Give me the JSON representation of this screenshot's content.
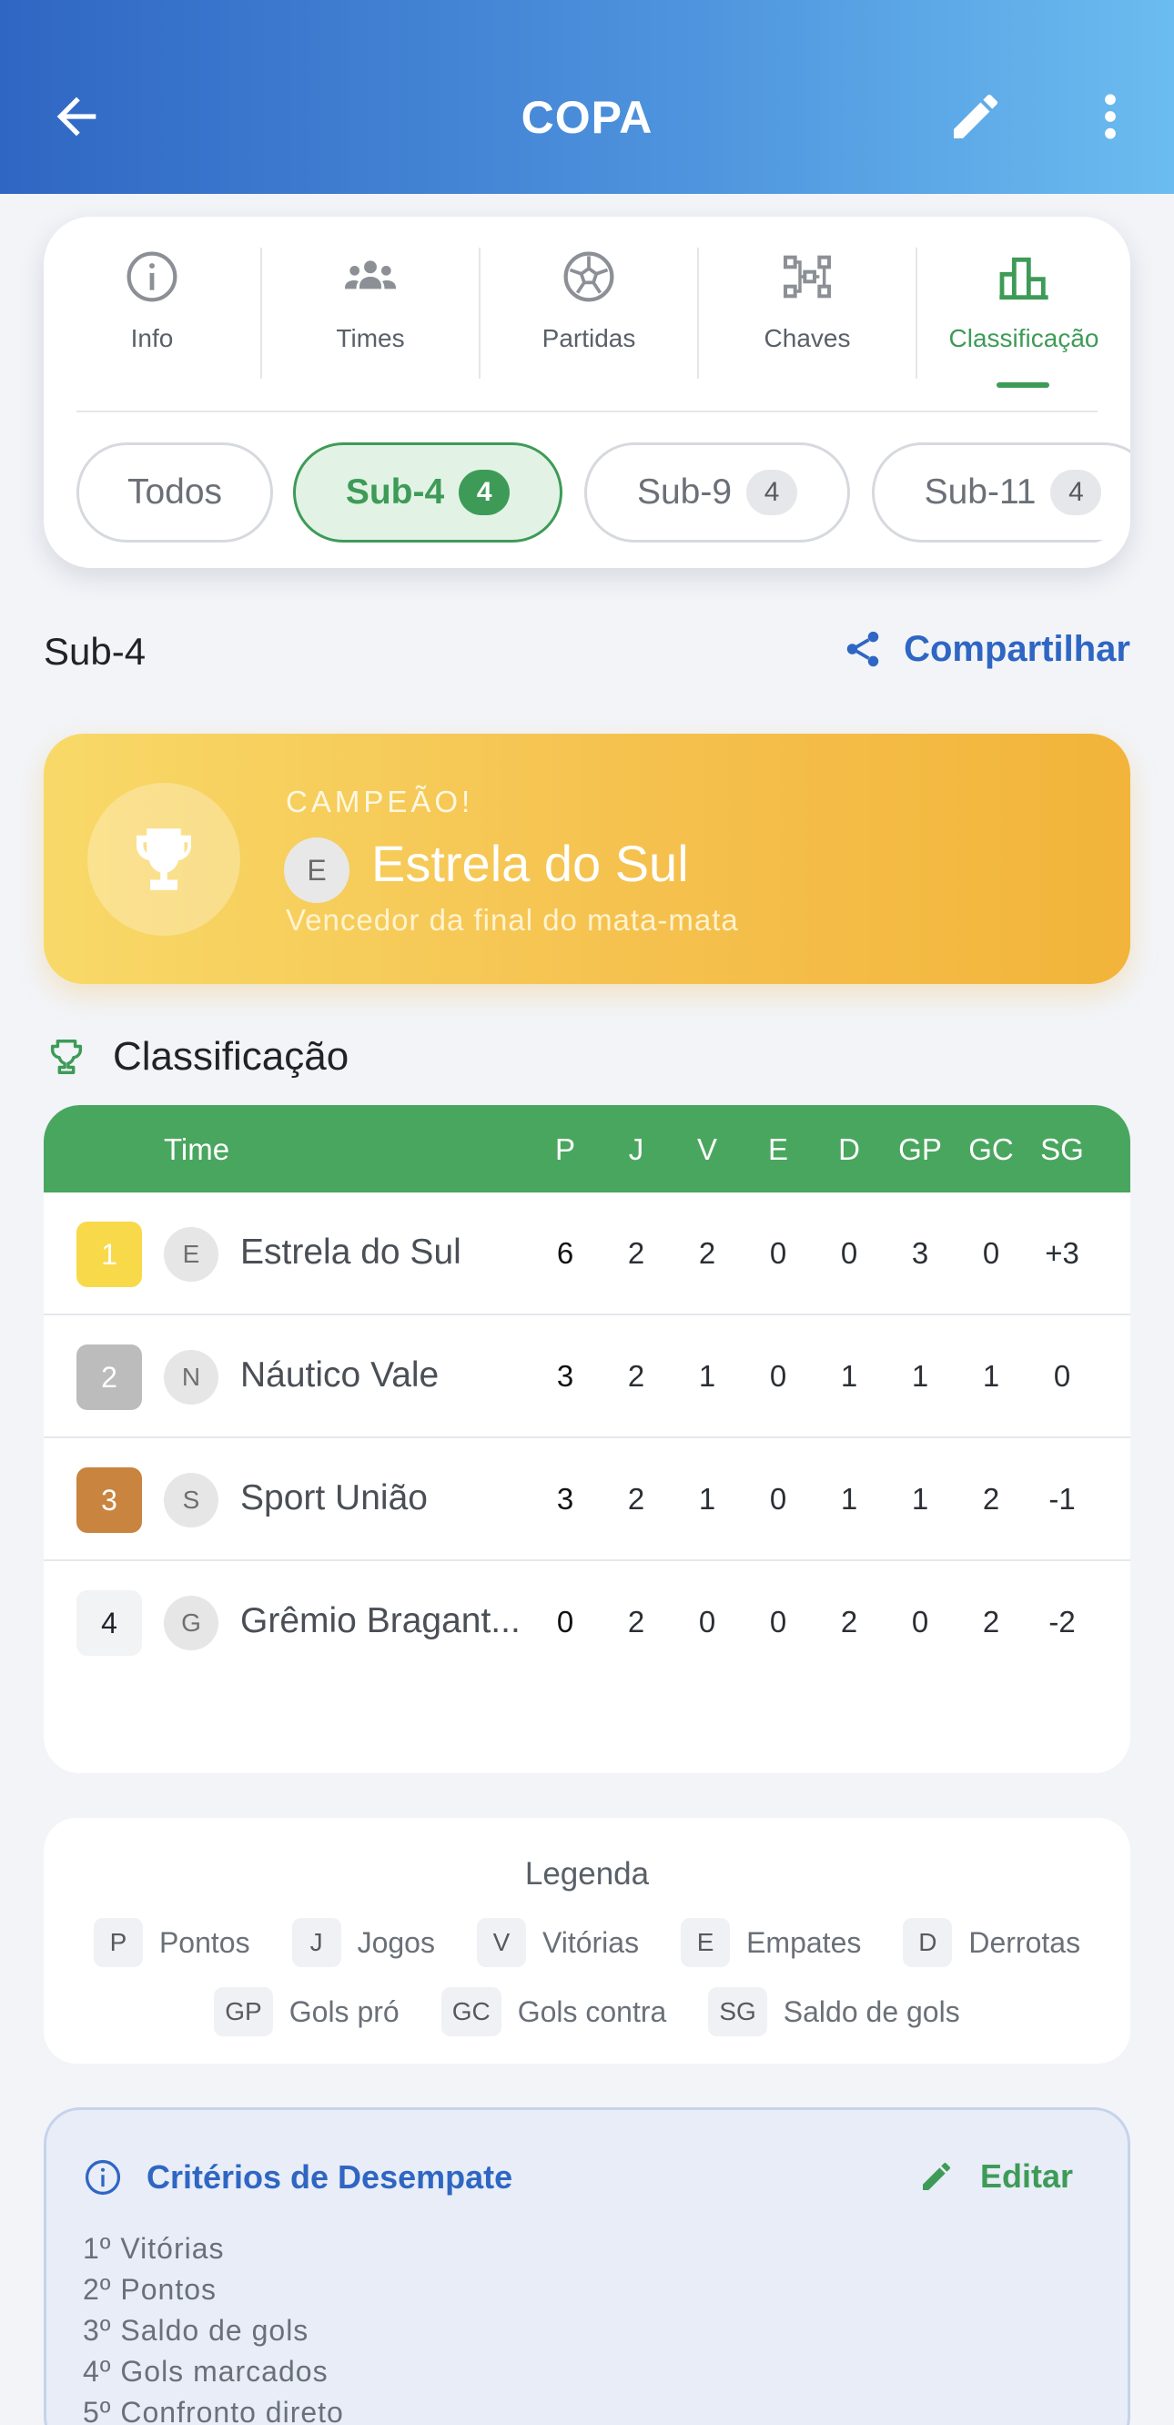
{
  "header": {
    "title": "COPA"
  },
  "tabs": [
    {
      "label": "Info",
      "icon": "info-icon"
    },
    {
      "label": "Times",
      "icon": "group-icon"
    },
    {
      "label": "Partidas",
      "icon": "soccer-ball-icon"
    },
    {
      "label": "Chaves",
      "icon": "bracket-icon"
    },
    {
      "label": "Classificação",
      "icon": "podium-icon",
      "active": true
    }
  ],
  "categories": [
    {
      "label": "Todos"
    },
    {
      "label": "Sub-4",
      "count": "4",
      "active": true
    },
    {
      "label": "Sub-9",
      "count": "4"
    },
    {
      "label": "Sub-11",
      "count": "4"
    }
  ],
  "section": {
    "title": "Sub-4",
    "share_label": "Compartilhar"
  },
  "champion": {
    "kicker": "CAMPEÃO!",
    "initial": "E",
    "team": "Estrela do Sul",
    "subtitle": "Vencedor da final do mata-mata",
    "color": "#f5c14e"
  },
  "standings": {
    "title": "Classificação",
    "header_color": "#49a65e",
    "columns": [
      "Time",
      "P",
      "J",
      "V",
      "E",
      "D",
      "GP",
      "GC",
      "SG"
    ],
    "rows": [
      {
        "pos": "1",
        "initial": "E",
        "team": "Estrela do Sul",
        "P": "6",
        "J": "2",
        "V": "2",
        "E": "0",
        "D": "0",
        "GP": "3",
        "GC": "0",
        "SG": "+3"
      },
      {
        "pos": "2",
        "initial": "N",
        "team": "Náutico Vale",
        "P": "3",
        "J": "2",
        "V": "1",
        "E": "0",
        "D": "1",
        "GP": "1",
        "GC": "1",
        "SG": "0"
      },
      {
        "pos": "3",
        "initial": "S",
        "team": "Sport União",
        "P": "3",
        "J": "2",
        "V": "1",
        "E": "0",
        "D": "1",
        "GP": "1",
        "GC": "2",
        "SG": "-1"
      },
      {
        "pos": "4",
        "initial": "G",
        "team": "Grêmio Bragant...",
        "P": "0",
        "J": "2",
        "V": "0",
        "E": "0",
        "D": "2",
        "GP": "0",
        "GC": "2",
        "SG": "-2"
      }
    ]
  },
  "legend": {
    "title": "Legenda",
    "items": [
      {
        "key": "P",
        "label": "Pontos"
      },
      {
        "key": "J",
        "label": "Jogos"
      },
      {
        "key": "V",
        "label": "Vitórias"
      },
      {
        "key": "E",
        "label": "Empates"
      },
      {
        "key": "D",
        "label": "Derrotas"
      },
      {
        "key": "GP",
        "label": "Gols pró"
      },
      {
        "key": "GC",
        "label": "Gols contra"
      },
      {
        "key": "SG",
        "label": "Saldo de gols"
      }
    ]
  },
  "tiebreak": {
    "title": "Critérios de Desempate",
    "edit_label": "Editar",
    "items": [
      "1º Vitórias",
      "2º Pontos",
      "3º Saldo de gols",
      "4º Gols marcados",
      "5º Confronto direto"
    ]
  }
}
